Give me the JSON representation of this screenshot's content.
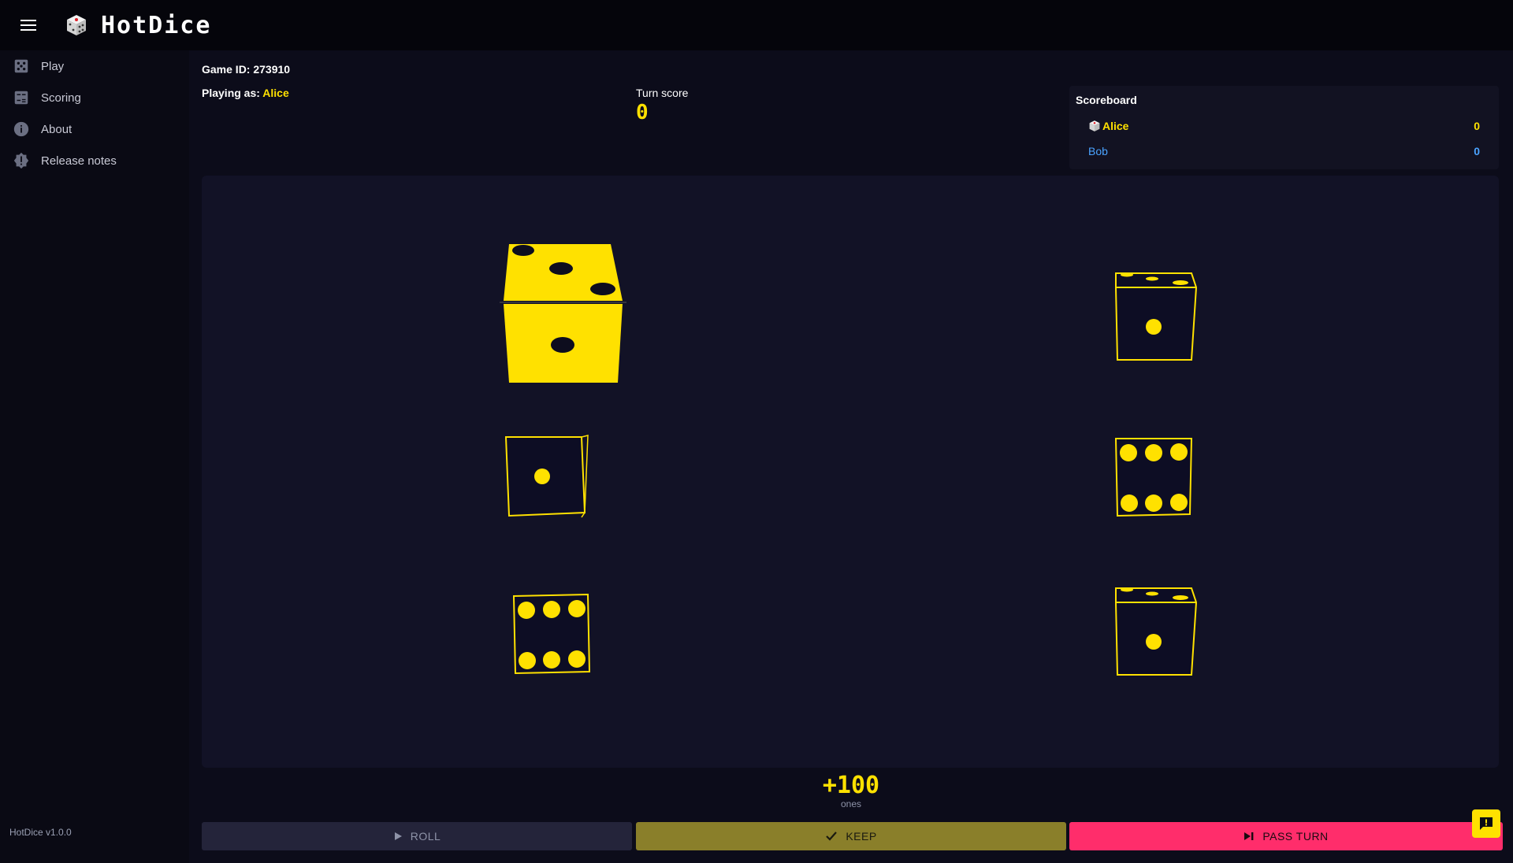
{
  "app": {
    "title": "HotDice",
    "version": "HotDice v1.0.0"
  },
  "nav": [
    {
      "label": "Play",
      "icon": "dice-icon"
    },
    {
      "label": "Scoring",
      "icon": "scoring-icon"
    },
    {
      "label": "About",
      "icon": "info-icon"
    },
    {
      "label": "Release notes",
      "icon": "new-releases-icon"
    }
  ],
  "game": {
    "id_text": "Game ID: 273910",
    "playing_as_label": "Playing as:",
    "player_name": "Alice",
    "turn_score_label": "Turn score",
    "turn_score": "0"
  },
  "scoreboard": {
    "title": "Scoreboard",
    "players": [
      {
        "name": "Alice",
        "score": "0",
        "color": "#ffe100",
        "active": true
      },
      {
        "name": "Bob",
        "score": "0",
        "color": "#4aa3ff",
        "active": false
      }
    ]
  },
  "dice": [
    {
      "value": 1,
      "selected": true
    },
    {
      "value": 1,
      "selected": false
    },
    {
      "value": 1,
      "selected": false
    },
    {
      "value": 6,
      "selected": false
    },
    {
      "value": 6,
      "selected": false
    },
    {
      "value": 1,
      "selected": false
    }
  ],
  "selection": {
    "delta": "+100",
    "label": "ones"
  },
  "actions": {
    "roll": "ROLL",
    "keep": "KEEP",
    "pass_turn": "PASS TURN"
  },
  "colors": {
    "accent": "#ffe100",
    "pass": "#ff2d6b",
    "board": "#121226"
  }
}
